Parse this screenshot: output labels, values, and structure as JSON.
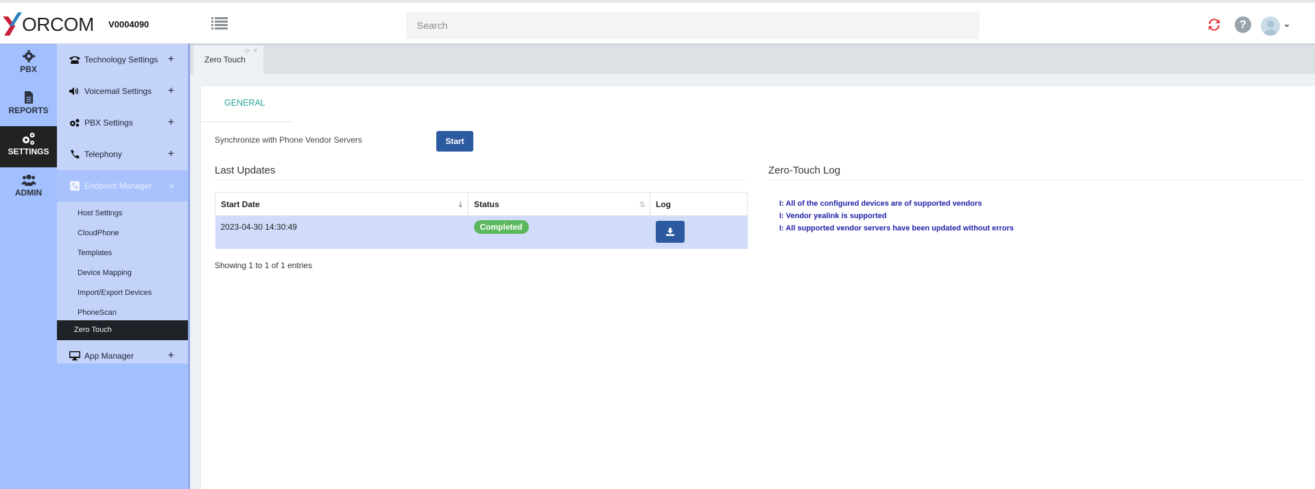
{
  "header": {
    "brand": "ORCOM",
    "version": "V0004090",
    "search_placeholder": "Search",
    "icons": [
      "menu-list-icon",
      "refresh-icon",
      "help-icon",
      "user-avatar-icon",
      "caret-down-icon"
    ]
  },
  "rail": {
    "items": [
      {
        "label": "PBX",
        "icon": "gear-icon"
      },
      {
        "label": "REPORTS",
        "icon": "document-icon"
      },
      {
        "label": "SETTINGS",
        "icon": "gears-icon",
        "active": true
      },
      {
        "label": "ADMIN",
        "icon": "users-icon"
      }
    ]
  },
  "subnav": {
    "items": [
      {
        "label": "Technology Settings",
        "icon": "phone-icon",
        "toggle": "+"
      },
      {
        "label": "Voicemail Settings",
        "icon": "volume-icon",
        "toggle": "+"
      },
      {
        "label": "PBX Settings",
        "icon": "gears-icon",
        "toggle": "+"
      },
      {
        "label": "Telephony",
        "icon": "handset-icon",
        "toggle": "+"
      },
      {
        "label": "Endpoint Manager",
        "icon": "phone-square-icon",
        "toggle": "×"
      },
      {
        "label": "App Manager",
        "icon": "desktop-icon",
        "toggle": "+"
      }
    ],
    "endpoint_children": [
      "Host Settings",
      "CloudPhone",
      "Templates",
      "Device Mapping",
      "Import/Export Devices",
      "PhoneScan",
      "Zero Touch"
    ],
    "active_child": "Zero Touch"
  },
  "tabs": [
    {
      "label": "Zero Touch",
      "reload": "⟳",
      "close": "×"
    }
  ],
  "panel": {
    "tab": "GENERAL",
    "sync_label": "Synchronize with Phone Vendor Servers",
    "start_button": "Start",
    "last_updates": {
      "title": "Last Updates",
      "columns": [
        "Start Date",
        "Status",
        "Log"
      ],
      "sort_icons": [
        "⇣",
        "⇅"
      ],
      "rows": [
        {
          "start_date": "2023-04-30 14:30:49",
          "status": "Completed"
        }
      ],
      "info": "Showing 1 to 1 of 1 entries"
    },
    "log": {
      "title": "Zero-Touch Log",
      "lines": [
        "I: All of the configured devices are of supported vendors",
        "I: Vendor yealink is supported",
        "I: All supported vendor servers have been updated without errors"
      ]
    }
  },
  "colors": {
    "accent": "#2c5aa0",
    "sidebar": "#a2bffe",
    "success": "#5cb85c",
    "tab_text": "#26a69a",
    "log_text": "#1e1ea8"
  }
}
